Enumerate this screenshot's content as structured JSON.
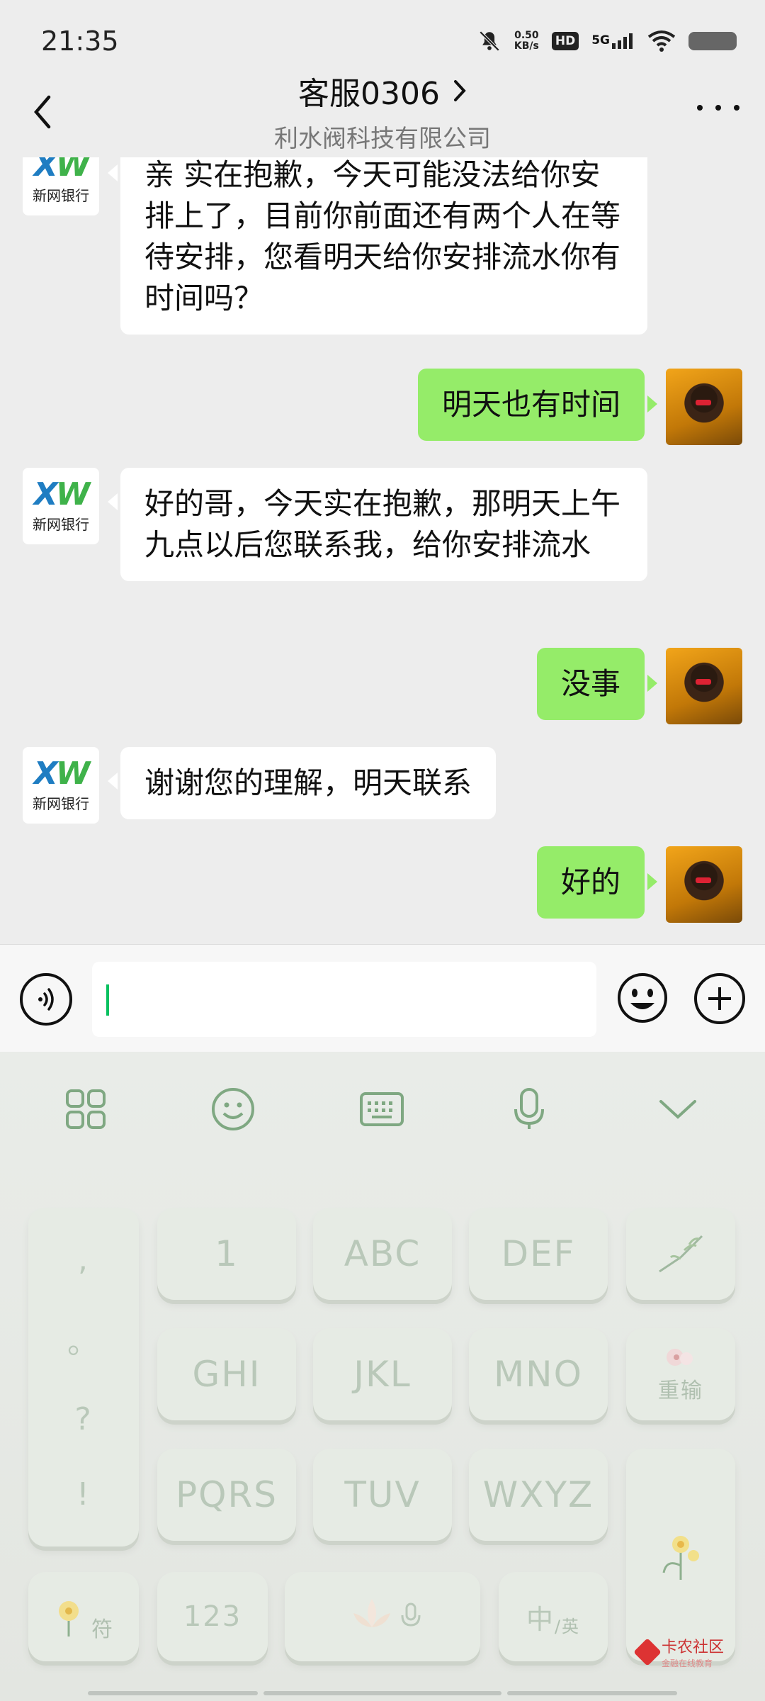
{
  "status": {
    "time": "21:35",
    "net_speed_value": "0.50",
    "net_speed_unit": "KB/s",
    "hd": "HD",
    "network": "5G"
  },
  "header": {
    "title": "客服0306",
    "subtitle": "利水阀科技有限公司"
  },
  "bank": {
    "logo_x": "X",
    "logo_w": "W",
    "name": "新网银行"
  },
  "messages": [
    {
      "side": "in",
      "text": "亲 实在抱歉，今天可能没法给你安排上了，目前你前面还有两个人在等待安排，您看明天给你安排流水你有时间吗？"
    },
    {
      "side": "out",
      "text": "明天也有时间"
    },
    {
      "side": "in",
      "text": "好的哥，今天实在抱歉，那明天上午九点以后您联系我，给你安排流水"
    },
    {
      "side": "out",
      "text": "没事"
    },
    {
      "side": "in",
      "text": "谢谢您的理解，明天联系"
    },
    {
      "side": "out",
      "text": "好的"
    }
  ],
  "keyboard": {
    "toolbar": [
      "grid-icon",
      "emoji-icon",
      "keyboard-icon",
      "mic-icon",
      "collapse-chevron-icon"
    ],
    "punct": [
      ",",
      "。",
      "?",
      "!"
    ],
    "row1": [
      "1",
      "ABC",
      "DEF"
    ],
    "row2": [
      "GHI",
      "JKL",
      "MNO"
    ],
    "row3": [
      "PQRS",
      "TUV",
      "WXYZ"
    ],
    "symbols_label": "符",
    "num_label": "123",
    "lang_label_main": "中",
    "lang_label_sub": "/英",
    "reenter_label": "重输"
  },
  "watermark": {
    "name": "卡农社区",
    "tagline": "金融在线教育"
  },
  "colors": {
    "outgoing_bubble": "#95ec69",
    "incoming_bubble": "#ffffff",
    "caret": "#07c160"
  }
}
